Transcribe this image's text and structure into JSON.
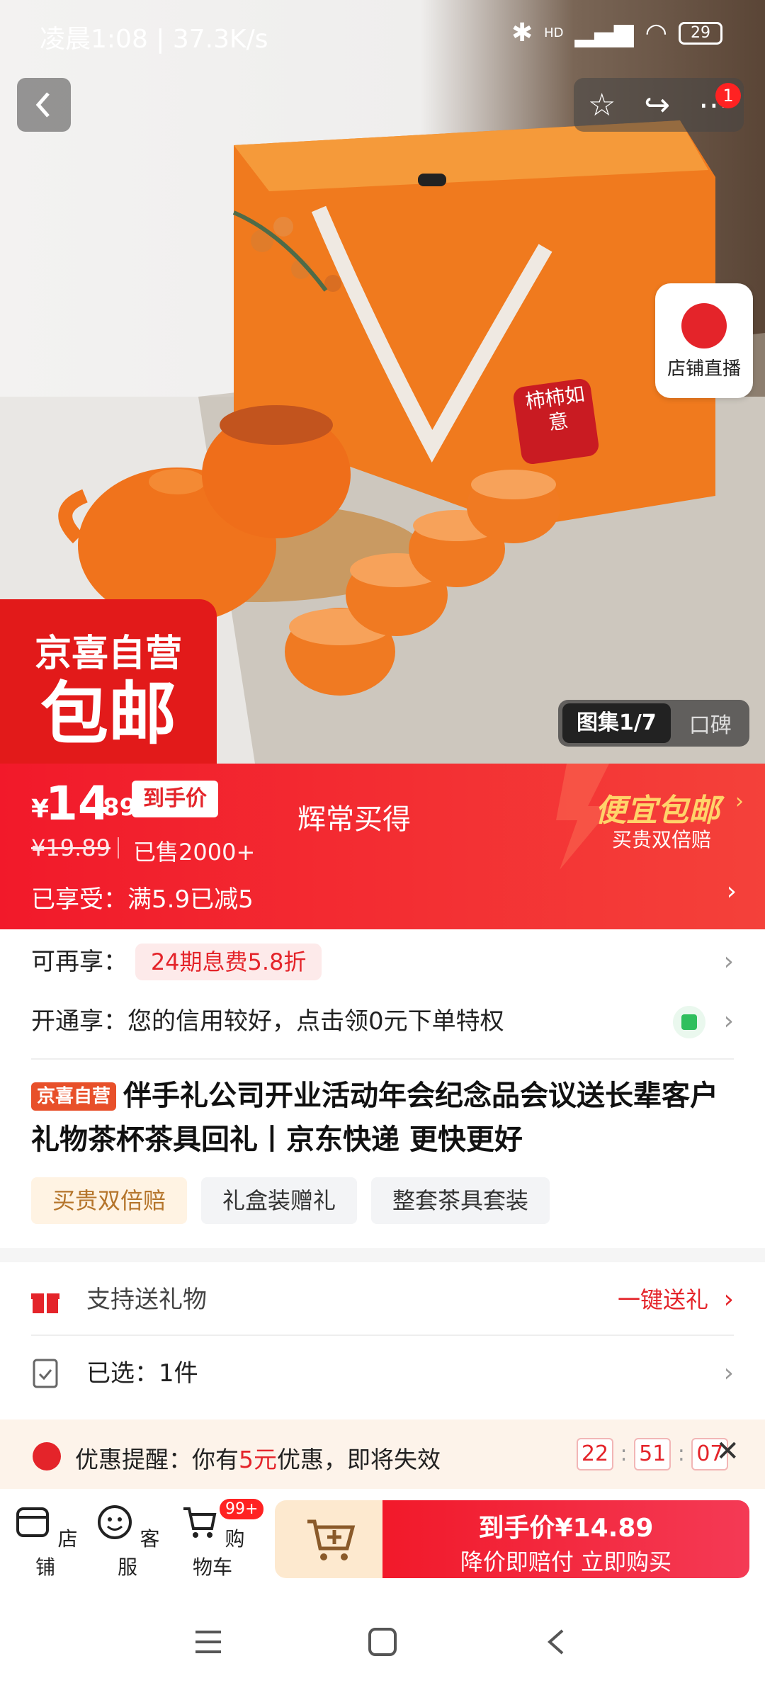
{
  "status_bar": {
    "left": "凌晨1:08 | 37.3K/s",
    "battery": "29",
    "hd": "HD"
  },
  "top_nav": {
    "notification_count": "1"
  },
  "live": {
    "label": "店铺直播"
  },
  "promo_box": {
    "line1": "京喜自营",
    "line2": "包邮"
  },
  "product_image_text": {
    "seal": "柿柿如意"
  },
  "gallery": {
    "active": "图集1/7",
    "other": "口碑"
  },
  "price": {
    "currency": "¥",
    "integer": "14",
    "decimal": ".89",
    "tag": "到手价",
    "slogan": "辉常买得",
    "original": "¥19.89",
    "sold": "已售2000+",
    "enjoyed": "已享受：满5.9已减5",
    "deal_title": "便宜包邮",
    "deal_sub": "买贵双倍赔"
  },
  "extra": {
    "label": "可再享：",
    "pill": "24期息费5.8折"
  },
  "credit": {
    "text": "开通享：您的信用较好，点击领0元下单特权"
  },
  "title": {
    "badge": "京喜自营",
    "text": "伴手礼公司开业活动年会纪念品会议送长辈客户礼物茶杯茶具回礼丨京东快递 更快更好"
  },
  "tags": [
    "买贵双倍赔",
    "礼盒装赠礼",
    "整套茶具套装"
  ],
  "gift_row": {
    "label": "支持送礼物",
    "action": "一键送礼"
  },
  "selected_row": {
    "label": "已选：1件"
  },
  "reminder": {
    "prefix": "优惠提醒：你有",
    "amount": "5元",
    "suffix": "优惠，即将失效",
    "hh": "22",
    "mm": "51",
    "ss": "07",
    "sep": ":"
  },
  "bottom_bar": {
    "store": "店铺",
    "service": "客服",
    "cart": "购物车",
    "cart_badge": "99+",
    "buy_line1": "到手价¥14.89",
    "buy_line2": "降价即赔付 立即购买"
  },
  "colors": {
    "brand_red": "#e4242a",
    "deal_gold": "#ffd36a"
  }
}
